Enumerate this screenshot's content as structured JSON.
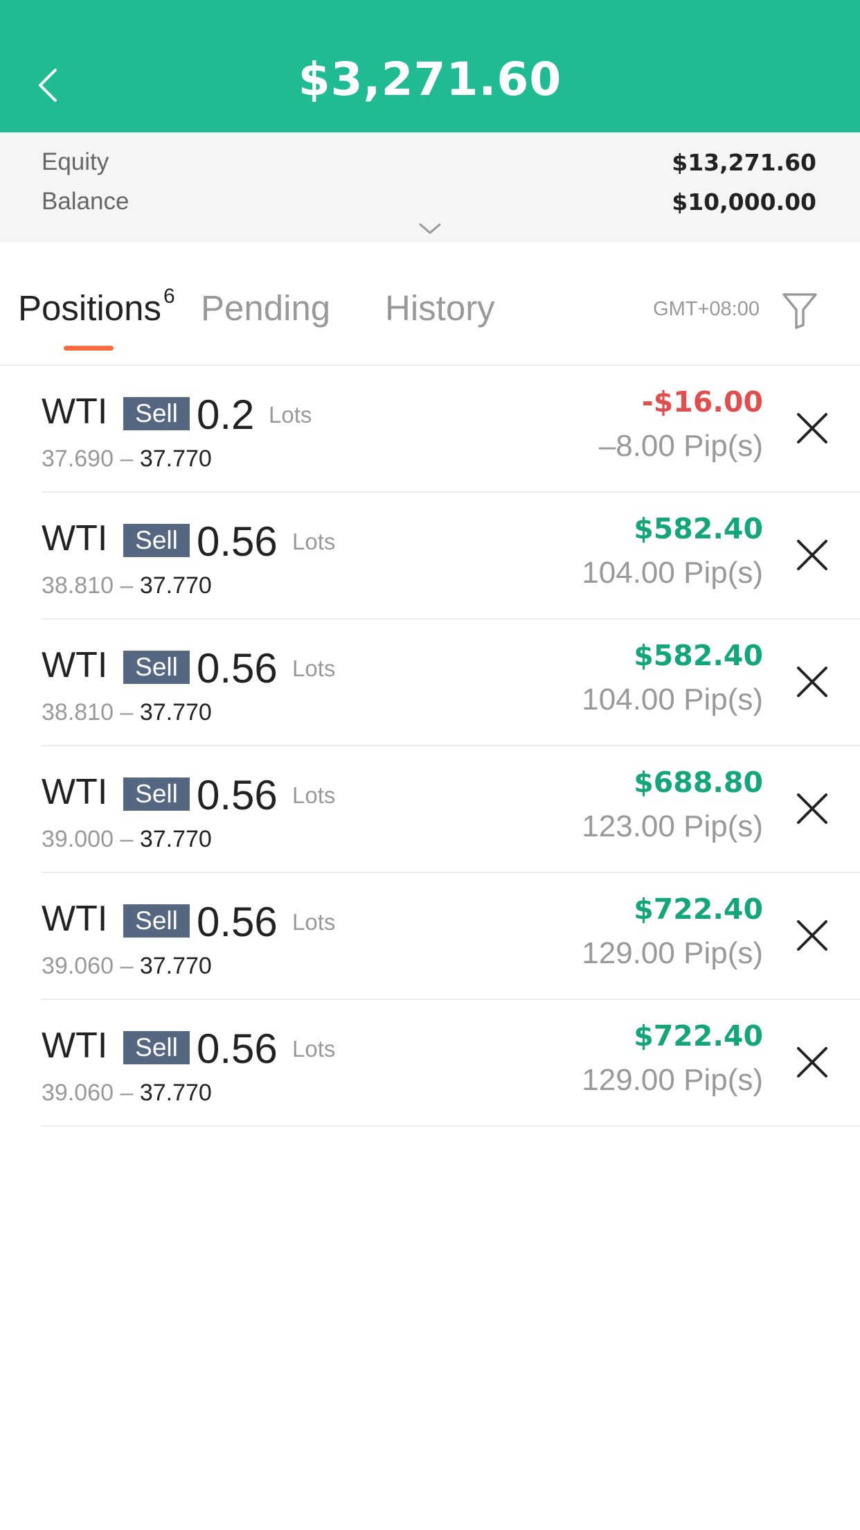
{
  "header": {
    "title": "$3,271.60",
    "back_icon": "chevron-left-icon",
    "background": "#20bb92"
  },
  "summary": {
    "equity_label": "Equity",
    "equity_value": "$13,271.60",
    "balance_label": "Balance",
    "balance_value": "$10,000.00",
    "expand_icon": "chevron-down-icon"
  },
  "tabs": {
    "positions_label": "Positions",
    "positions_count": "6",
    "pending_label": "Pending",
    "history_label": "History",
    "timezone": "GMT+08:00",
    "filter_icon": "filter-icon",
    "indicator_color": "#ff6b3d"
  },
  "lots_unit": "Lots",
  "positions": [
    {
      "symbol": "WTI",
      "side": "Sell",
      "lots": "0.2",
      "open": "37.690",
      "sep": "–",
      "current": "37.770",
      "pnl": "-$16.00",
      "pips": "–8.00 Pip(s)",
      "sign": "neg"
    },
    {
      "symbol": "WTI",
      "side": "Sell",
      "lots": "0.56",
      "open": "38.810",
      "sep": "–",
      "current": "37.770",
      "pnl": "$582.40",
      "pips": "104.00 Pip(s)",
      "sign": "pos"
    },
    {
      "symbol": "WTI",
      "side": "Sell",
      "lots": "0.56",
      "open": "38.810",
      "sep": "–",
      "current": "37.770",
      "pnl": "$582.40",
      "pips": "104.00 Pip(s)",
      "sign": "pos"
    },
    {
      "symbol": "WTI",
      "side": "Sell",
      "lots": "0.56",
      "open": "39.000",
      "sep": "–",
      "current": "37.770",
      "pnl": "$688.80",
      "pips": "123.00 Pip(s)",
      "sign": "pos"
    },
    {
      "symbol": "WTI",
      "side": "Sell",
      "lots": "0.56",
      "open": "39.060",
      "sep": "–",
      "current": "37.770",
      "pnl": "$722.40",
      "pips": "129.00 Pip(s)",
      "sign": "pos"
    },
    {
      "symbol": "WTI",
      "side": "Sell",
      "lots": "0.56",
      "open": "39.060",
      "sep": "–",
      "current": "37.770",
      "pnl": "$722.40",
      "pips": "129.00 Pip(s)",
      "sign": "pos"
    }
  ],
  "colors": {
    "profit": "#14a57a",
    "loss": "#e04f4f",
    "sell_badge": "#566781"
  }
}
